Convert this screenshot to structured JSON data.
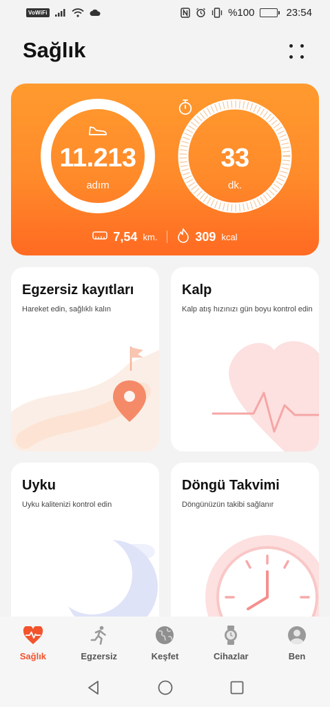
{
  "status_bar": {
    "vowifi": "VoWiFi",
    "battery_text": "%100",
    "time": "23:54"
  },
  "header": {
    "title": "Sağlık"
  },
  "activity": {
    "steps_value": "11.213",
    "steps_unit": "adım",
    "minutes_value": "33",
    "minutes_unit": "dk.",
    "distance_value": "7,54",
    "distance_unit": "km.",
    "calories_value": "309",
    "calories_unit": "kcal",
    "colors": {
      "card_top": "#ff9a2e",
      "card_bottom": "#ff6a22"
    }
  },
  "tiles": [
    {
      "title": "Egzersiz kayıtları",
      "subtitle": "Hareket edin, sağlıklı kalın"
    },
    {
      "title": "Kalp",
      "subtitle": "Kalp atış hızınızı gün boyu kontrol edin"
    },
    {
      "title": "Uyku",
      "subtitle": "Uyku kalitenizi kontrol edin"
    },
    {
      "title": "Döngü Takvimi",
      "subtitle": "Döngünüzün takibi sağlanır"
    }
  ],
  "bottom_nav": [
    {
      "label": "Sağlık",
      "icon": "heart-pulse-icon",
      "active": true
    },
    {
      "label": "Egzersiz",
      "icon": "running-icon",
      "active": false
    },
    {
      "label": "Keşfet",
      "icon": "globe-icon",
      "active": false
    },
    {
      "label": "Cihazlar",
      "icon": "watch-icon",
      "active": false
    },
    {
      "label": "Ben",
      "icon": "profile-icon",
      "active": false
    }
  ],
  "accent_color": "#f2542d"
}
